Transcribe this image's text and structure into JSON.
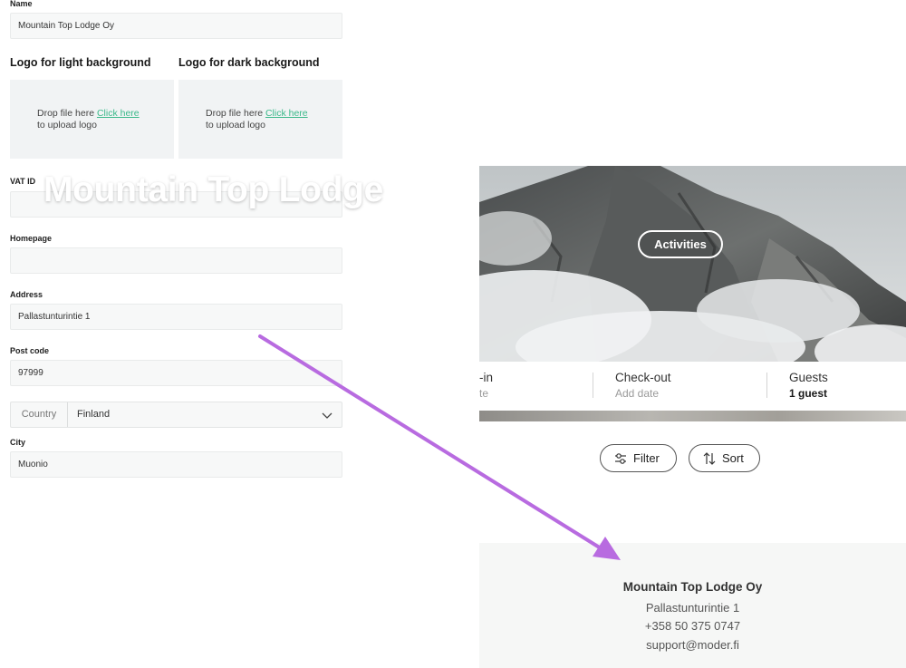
{
  "form": {
    "name_label": "Name",
    "name_value": "Mountain Top Lodge Oy",
    "logo_light_heading": "Logo for light background",
    "logo_dark_heading": "Logo for dark background",
    "drop_text": "Drop file here",
    "drop_link": "Click here",
    "drop_text2": "to upload logo",
    "vat_label": "VAT ID",
    "vat_value": "",
    "homepage_label": "Homepage",
    "homepage_value": "",
    "address_label": "Address",
    "address_value": "Pallastunturintie 1",
    "postcode_label": "Post code",
    "postcode_value": "97999",
    "country_label": "Country",
    "country_value": "Finland",
    "city_label": "City",
    "city_value": "Muonio"
  },
  "preview": {
    "hero_title": "Mountain Top Lodge",
    "activities_label": "Activities",
    "checkin_label": "-in",
    "checkin_sub": "te",
    "checkout_label": "Check-out",
    "checkout_sub": "Add date",
    "guests_label": "Guests",
    "guests_value": "1 guest",
    "filter_label": "Filter",
    "sort_label": "Sort",
    "footer_name": "Mountain Top Lodge Oy",
    "footer_address": "Pallastunturintie 1",
    "footer_phone": "+358 50 375 0747",
    "footer_email": "support@moder.fi"
  },
  "colors": {
    "link": "#3bb98a",
    "annotation_arrow": "#b86be0"
  },
  "icons": {
    "chevron": "chevron-down-icon",
    "filter": "sliders-icon",
    "sort": "sort-arrows-icon",
    "arrow": "annotation-arrow"
  }
}
